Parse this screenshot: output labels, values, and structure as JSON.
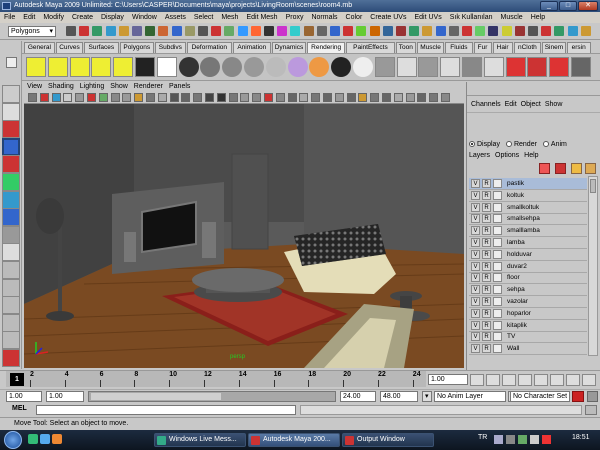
{
  "window": {
    "title": "Autodesk Maya 2009 Unlimited: C:\\Users\\CASPER\\Documents\\maya\\projects\\LivingRoom\\scenes\\room4.mb",
    "btn_min": "_",
    "btn_max": "□",
    "btn_close": "✕"
  },
  "menubar": [
    "File",
    "Edit",
    "Modify",
    "Create",
    "Display",
    "Window",
    "Assets",
    "Select",
    "Mesh",
    "Edit Mesh",
    "Proxy",
    "Normals",
    "Color",
    "Create UVs",
    "Edit UVs",
    "Sık Kullanılan",
    "Muscle",
    "Help"
  ],
  "status_line": {
    "mode": "Polygons"
  },
  "shelf_tabs": [
    "General",
    "Curves",
    "Surfaces",
    "Polygons",
    "Subdivs",
    "Deformation",
    "Animation",
    "Dynamics",
    "Rendering",
    "PaintEffects",
    "Toon",
    "Muscle",
    "Fluids",
    "Fur",
    "Hair",
    "nCloth",
    "Sinem",
    "ersin"
  ],
  "shelf_active": "Rendering",
  "viewport": {
    "menu": [
      "View",
      "Shading",
      "Lighting",
      "Show",
      "Renderer",
      "Panels"
    ],
    "camera_label": "persp"
  },
  "channel_box": {
    "menu": [
      "Channels",
      "Edit",
      "Object",
      "Show"
    ],
    "display_radios": [
      {
        "label": "Display",
        "on": true
      },
      {
        "label": "Render",
        "on": false
      },
      {
        "label": "Anim",
        "on": false
      }
    ],
    "layer_menu": [
      "Layers",
      "Options",
      "Help"
    ],
    "layers": [
      "pastik",
      "koltuk",
      "smallkoltuk",
      "smallsehpa",
      "smalllamba",
      "lamba",
      "holduvar",
      "duvar2",
      "floor",
      "sehpa",
      "vazolar",
      "hoparlor",
      "kitaplik",
      "TV",
      "Wall"
    ],
    "v_label": "V",
    "r_label": "R",
    "selected_layer_index": 0
  },
  "time_slider": {
    "ticks": [
      "2",
      "4",
      "6",
      "8",
      "10",
      "12",
      "14",
      "16",
      "18",
      "20",
      "22",
      "24"
    ],
    "current_frame": "1",
    "current_time_field": "1.00"
  },
  "range_slider": {
    "start": "1.00",
    "playback_start": "1.00",
    "playback_end": "24.00",
    "end": "48.00",
    "anim_layer": "No Anim Layer",
    "character_set": "No Character Set"
  },
  "command_line": {
    "label": "MEL"
  },
  "help_line": {
    "text": "Move Tool: Select an object to move."
  },
  "taskbar": {
    "tasks": [
      "Windows Live Mess...",
      "Autodesk Maya 200...",
      "Output Window"
    ],
    "lang": "TR",
    "clock": "18:51"
  }
}
